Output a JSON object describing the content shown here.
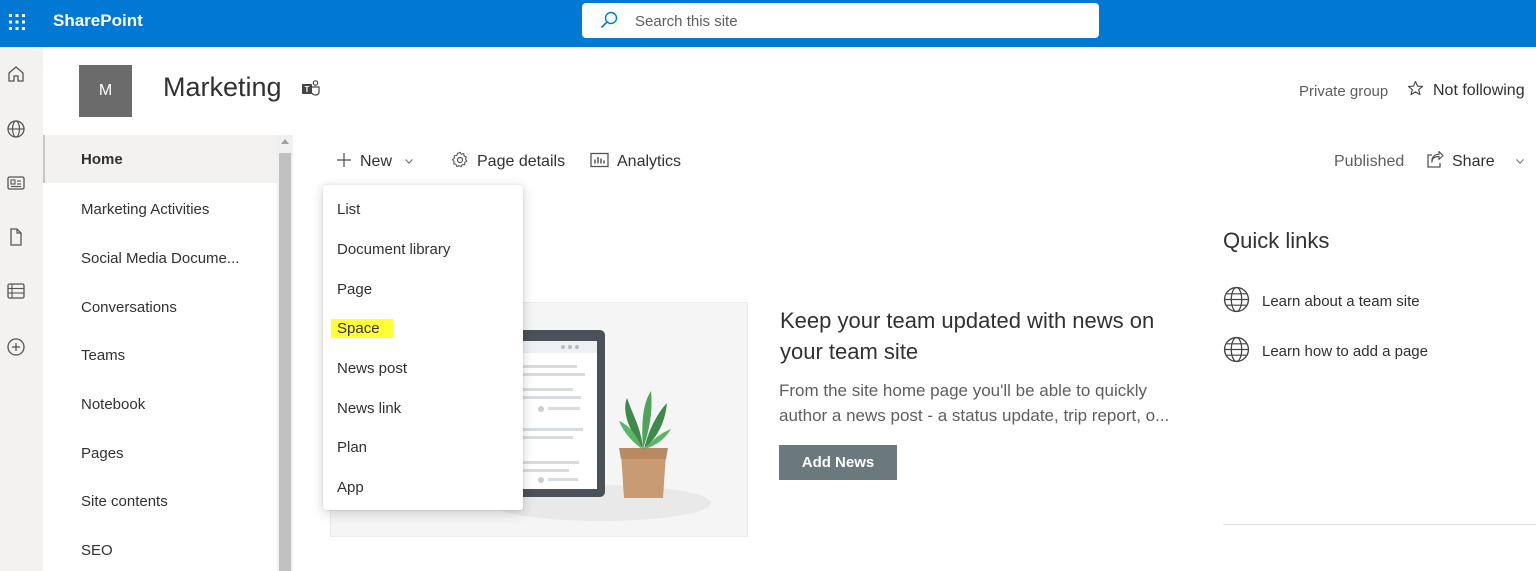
{
  "suite": {
    "brand": "SharePoint",
    "search_placeholder": "Search this site",
    "accent": "#0078d4"
  },
  "site": {
    "logo_letter": "M",
    "title": "Marketing",
    "privacy": "Private group",
    "follow_label": "Not following"
  },
  "nav": {
    "items": [
      {
        "label": "Home",
        "selected": true
      },
      {
        "label": "Marketing Activities"
      },
      {
        "label": "Social Media Docume..."
      },
      {
        "label": "Conversations"
      },
      {
        "label": "Teams"
      },
      {
        "label": "Notebook"
      },
      {
        "label": "Pages"
      },
      {
        "label": "Site contents"
      },
      {
        "label": "SEO"
      }
    ]
  },
  "commandbar": {
    "new_label": "New",
    "page_details_label": "Page details",
    "analytics_label": "Analytics",
    "status": "Published",
    "share_label": "Share"
  },
  "new_menu": {
    "items": [
      "List",
      "Document library",
      "Page",
      "Space",
      "News post",
      "News link",
      "Plan",
      "App"
    ],
    "highlighted": "Space",
    "highlight_color": "#ffff33"
  },
  "news": {
    "heading": "Keep your team updated with news on your team site",
    "description": "From the site home page you'll be able to quickly author a news post - a status update, trip report, o...",
    "button_label": "Add News"
  },
  "quick_links": {
    "title": "Quick links",
    "items": [
      "Learn about a team site",
      "Learn how to add a page"
    ]
  }
}
